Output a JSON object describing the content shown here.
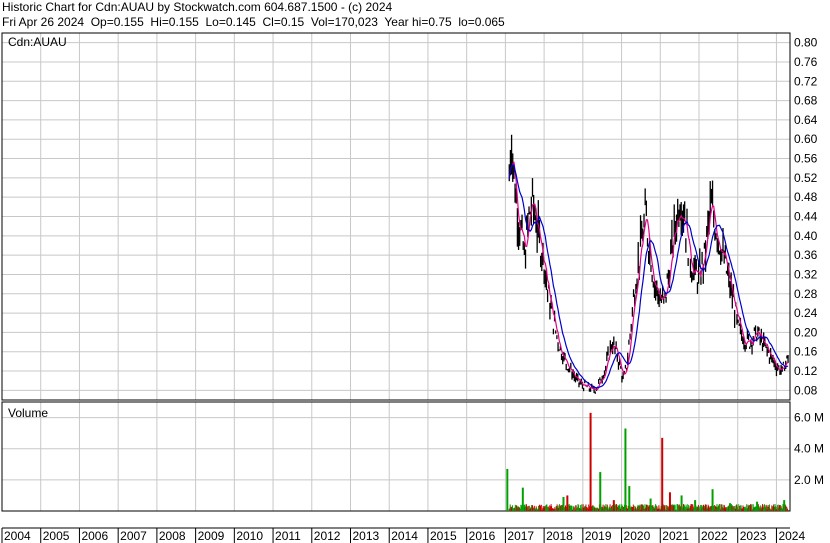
{
  "header": {
    "line1": "Historic Chart for Cdn:AUAU by Stockwatch.com 604.687.1500 - (c) 2024",
    "line2": "Fri Apr 26 2024  Op=0.155  Hi=0.155  Lo=0.145  Cl=0.15  Vol=170,023  Year hi=0.75  lo=0.065"
  },
  "chart_data": [
    {
      "type": "line",
      "title": "Cdn:AUAU",
      "ylim": [
        0.06,
        0.82
      ],
      "y_ticks": [
        "0.80",
        "0.76",
        "0.72",
        "0.68",
        "0.64",
        "0.60",
        "0.56",
        "0.52",
        "0.48",
        "0.44",
        "0.40",
        "0.36",
        "0.32",
        "0.28",
        "0.24",
        "0.20",
        "0.16",
        "0.12",
        "0.08"
      ],
      "y_tick_values": [
        0.8,
        0.76,
        0.72,
        0.68,
        0.64,
        0.6,
        0.56,
        0.52,
        0.48,
        0.44,
        0.4,
        0.36,
        0.32,
        0.28,
        0.24,
        0.2,
        0.16,
        0.12,
        0.08
      ],
      "xlim": [
        2004.0,
        2024.35
      ],
      "grid": true,
      "colors": {
        "price": "#000000",
        "ma_short": "#e0008a",
        "ma_long": "#0000cc"
      },
      "series": [
        {
          "x": [
            2017.1,
            2017.15,
            2017.2,
            2017.28,
            2017.38,
            2017.5,
            2017.6,
            2017.72,
            2017.85,
            2018.0,
            2018.1,
            2018.25,
            2018.4,
            2018.55,
            2018.7,
            2018.85,
            2019.0,
            2019.15,
            2019.3,
            2019.45,
            2019.6,
            2019.75,
            2019.9,
            2020.05,
            2020.15,
            2020.25,
            2020.35,
            2020.5,
            2020.62,
            2020.75,
            2020.85,
            2021.0,
            2021.1,
            2021.2,
            2021.35,
            2021.5,
            2021.62,
            2021.75,
            2021.85,
            2022.0,
            2022.15,
            2022.3,
            2022.5,
            2022.7,
            2022.9,
            2023.0,
            2023.15,
            2023.3,
            2023.5,
            2023.7,
            2023.85,
            2024.0,
            2024.15,
            2024.3
          ],
          "y": [
            0.52,
            0.62,
            0.55,
            0.47,
            0.42,
            0.35,
            0.44,
            0.47,
            0.4,
            0.35,
            0.28,
            0.22,
            0.17,
            0.14,
            0.12,
            0.1,
            0.09,
            0.085,
            0.08,
            0.1,
            0.13,
            0.18,
            0.15,
            0.1,
            0.14,
            0.22,
            0.3,
            0.38,
            0.44,
            0.36,
            0.3,
            0.27,
            0.26,
            0.31,
            0.4,
            0.48,
            0.45,
            0.36,
            0.33,
            0.31,
            0.36,
            0.46,
            0.4,
            0.33,
            0.26,
            0.21,
            0.19,
            0.18,
            0.2,
            0.17,
            0.15,
            0.13,
            0.12,
            0.15
          ]
        }
      ]
    },
    {
      "type": "bar",
      "title": "Volume",
      "ylim": [
        0,
        7000000
      ],
      "y_ticks": [
        "6.0 M",
        "4.0 M",
        "2.0 M"
      ],
      "y_tick_values": [
        6000000,
        4000000,
        2000000
      ],
      "x_tick_labels": [
        "2004",
        "2005",
        "2006",
        "2007",
        "2008",
        "2009",
        "2010",
        "2011",
        "2012",
        "2013",
        "2014",
        "2015",
        "2016",
        "2017",
        "2018",
        "2019",
        "2020",
        "2021",
        "2022",
        "2023",
        "2024"
      ],
      "x_tick_values": [
        2004,
        2005,
        2006,
        2007,
        2008,
        2009,
        2010,
        2011,
        2012,
        2013,
        2014,
        2015,
        2016,
        2017,
        2018,
        2019,
        2020,
        2021,
        2022,
        2023,
        2024
      ],
      "spikes": [
        {
          "x": 2017.05,
          "v": 2700000,
          "color": "#00a000"
        },
        {
          "x": 2017.45,
          "v": 1500000,
          "color": "#00a000"
        },
        {
          "x": 2018.5,
          "v": 900000,
          "color": "#00a000"
        },
        {
          "x": 2018.6,
          "v": 1000000,
          "color": "#cc0000"
        },
        {
          "x": 2019.2,
          "v": 6300000,
          "color": "#cc0000"
        },
        {
          "x": 2019.45,
          "v": 2500000,
          "color": "#00a000"
        },
        {
          "x": 2019.8,
          "v": 700000,
          "color": "#cc0000"
        },
        {
          "x": 2020.1,
          "v": 5300000,
          "color": "#00a000"
        },
        {
          "x": 2020.2,
          "v": 1600000,
          "color": "#00a000"
        },
        {
          "x": 2020.75,
          "v": 800000,
          "color": "#00a000"
        },
        {
          "x": 2021.05,
          "v": 4700000,
          "color": "#cc0000"
        },
        {
          "x": 2021.25,
          "v": 1200000,
          "color": "#cc0000"
        },
        {
          "x": 2021.55,
          "v": 1000000,
          "color": "#00a000"
        },
        {
          "x": 2021.9,
          "v": 700000,
          "color": "#00a000"
        },
        {
          "x": 2022.35,
          "v": 1400000,
          "color": "#00a000"
        },
        {
          "x": 2022.8,
          "v": 500000,
          "color": "#00a000"
        },
        {
          "x": 2023.5,
          "v": 600000,
          "color": "#00a000"
        },
        {
          "x": 2024.2,
          "v": 700000,
          "color": "#00a000"
        }
      ]
    }
  ]
}
